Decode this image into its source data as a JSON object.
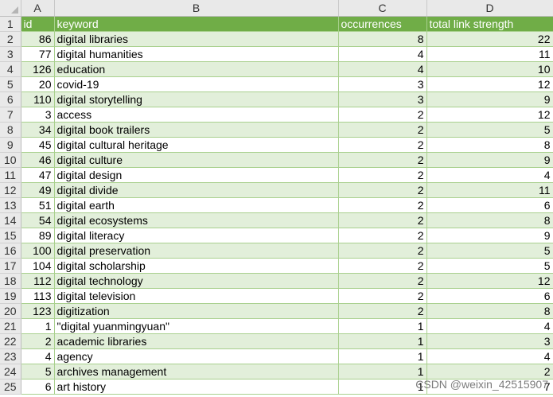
{
  "columns": [
    "A",
    "B",
    "C",
    "D"
  ],
  "header": {
    "row_num": "1",
    "id": "id",
    "keyword": "keyword",
    "occurrences": "occurrences",
    "strength": "total link strength"
  },
  "rows": [
    {
      "n": "2",
      "id": "86",
      "keyword": "digital libraries",
      "occ": "8",
      "tls": "22"
    },
    {
      "n": "3",
      "id": "77",
      "keyword": "digital humanities",
      "occ": "4",
      "tls": "11"
    },
    {
      "n": "4",
      "id": "126",
      "keyword": "education",
      "occ": "4",
      "tls": "10"
    },
    {
      "n": "5",
      "id": "20",
      "keyword": "covid-19",
      "occ": "3",
      "tls": "12"
    },
    {
      "n": "6",
      "id": "110",
      "keyword": "digital storytelling",
      "occ": "3",
      "tls": "9"
    },
    {
      "n": "7",
      "id": "3",
      "keyword": "access",
      "occ": "2",
      "tls": "12"
    },
    {
      "n": "8",
      "id": "34",
      "keyword": "digital book trailers",
      "occ": "2",
      "tls": "5"
    },
    {
      "n": "9",
      "id": "45",
      "keyword": "digital cultural heritage",
      "occ": "2",
      "tls": "8"
    },
    {
      "n": "10",
      "id": "46",
      "keyword": "digital culture",
      "occ": "2",
      "tls": "9"
    },
    {
      "n": "11",
      "id": "47",
      "keyword": "digital design",
      "occ": "2",
      "tls": "4"
    },
    {
      "n": "12",
      "id": "49",
      "keyword": "digital divide",
      "occ": "2",
      "tls": "11"
    },
    {
      "n": "13",
      "id": "51",
      "keyword": "digital earth",
      "occ": "2",
      "tls": "6"
    },
    {
      "n": "14",
      "id": "54",
      "keyword": "digital ecosystems",
      "occ": "2",
      "tls": "8"
    },
    {
      "n": "15",
      "id": "89",
      "keyword": "digital literacy",
      "occ": "2",
      "tls": "9"
    },
    {
      "n": "16",
      "id": "100",
      "keyword": "digital preservation",
      "occ": "2",
      "tls": "5"
    },
    {
      "n": "17",
      "id": "104",
      "keyword": "digital scholarship",
      "occ": "2",
      "tls": "5"
    },
    {
      "n": "18",
      "id": "112",
      "keyword": "digital technology",
      "occ": "2",
      "tls": "12"
    },
    {
      "n": "19",
      "id": "113",
      "keyword": "digital television",
      "occ": "2",
      "tls": "6"
    },
    {
      "n": "20",
      "id": "123",
      "keyword": "digitization",
      "occ": "2",
      "tls": "8"
    },
    {
      "n": "21",
      "id": "1",
      "keyword": "\"digital yuanmingyuan\"",
      "occ": "1",
      "tls": "4"
    },
    {
      "n": "22",
      "id": "2",
      "keyword": "academic libraries",
      "occ": "1",
      "tls": "3"
    },
    {
      "n": "23",
      "id": "4",
      "keyword": "agency",
      "occ": "1",
      "tls": "4"
    },
    {
      "n": "24",
      "id": "5",
      "keyword": "archives management",
      "occ": "1",
      "tls": "2"
    },
    {
      "n": "25",
      "id": "6",
      "keyword": "art history",
      "occ": "1",
      "tls": "7"
    }
  ],
  "watermark": "CSDN @weixin_42515907",
  "colors": {
    "header_green": "#70ad47",
    "band_green": "#e2efda",
    "border_green": "#a9d08e"
  }
}
